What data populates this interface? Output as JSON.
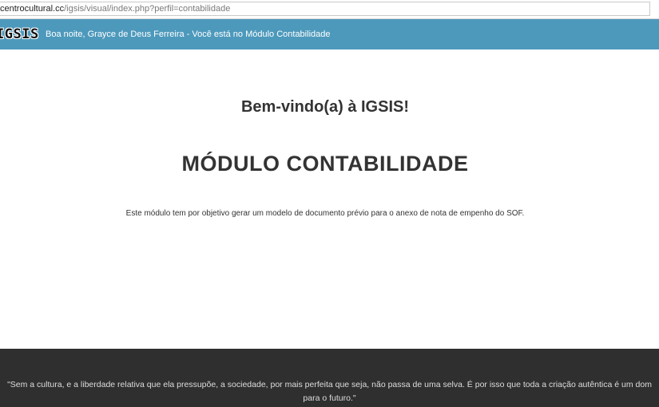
{
  "browser": {
    "url_host": "centrocultural.cc",
    "url_path": "/igsis/visual/index.php?perfil=contabilidade"
  },
  "header": {
    "logo": "IGSIS",
    "greeting": "Boa noite, Grayce de Deus Ferreira - Você está no Módulo Contabilidade",
    "background_color": "#4d99bc"
  },
  "main": {
    "welcome": "Bem-vindo(a) à IGSIS!",
    "module_title": "MÓDULO CONTABILIDADE",
    "description": "Este módulo tem por objetivo gerar um modelo de documento prévio para o anexo de nota de empenho do SOF."
  },
  "footer": {
    "quote_line1": "\"Sem a cultura, e a liberdade relativa que ela pressupõe, a sociedade, por mais perfeita que seja, não passa de uma selva. É por isso que toda a criação autêntica é um dom",
    "quote_line2": "para o futuro.\"",
    "background_color": "#2f2f2f"
  }
}
